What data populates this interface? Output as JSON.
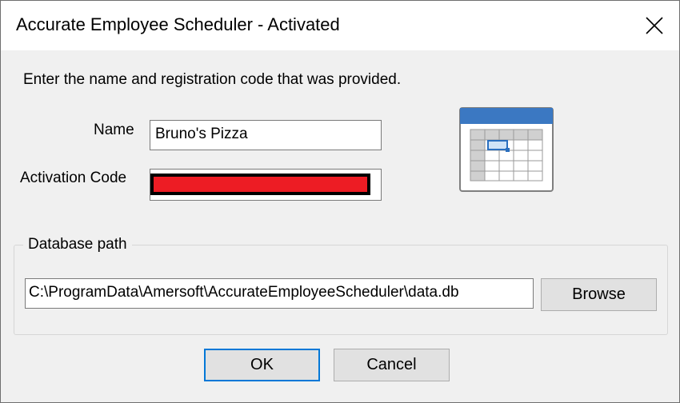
{
  "window": {
    "title": "Accurate Employee Scheduler - Activated"
  },
  "form": {
    "instructions": "Enter the name and registration code that was provided.",
    "name_label": "Name",
    "name_value": "Bruno's Pizza",
    "code_label": "Activation Code",
    "code_value": ""
  },
  "database": {
    "group_label": "Database path",
    "path_value": "C:\\ProgramData\\Amersoft\\AccurateEmployeeScheduler\\data.db",
    "browse_label": "Browse"
  },
  "buttons": {
    "ok_label": "OK",
    "cancel_label": "Cancel"
  },
  "colors": {
    "accent": "#0078d7",
    "redaction": "#ed1c24",
    "calendar_header": "#3b78c2"
  },
  "icons": {
    "close": "close-icon",
    "app": "calendar-grid-icon"
  }
}
